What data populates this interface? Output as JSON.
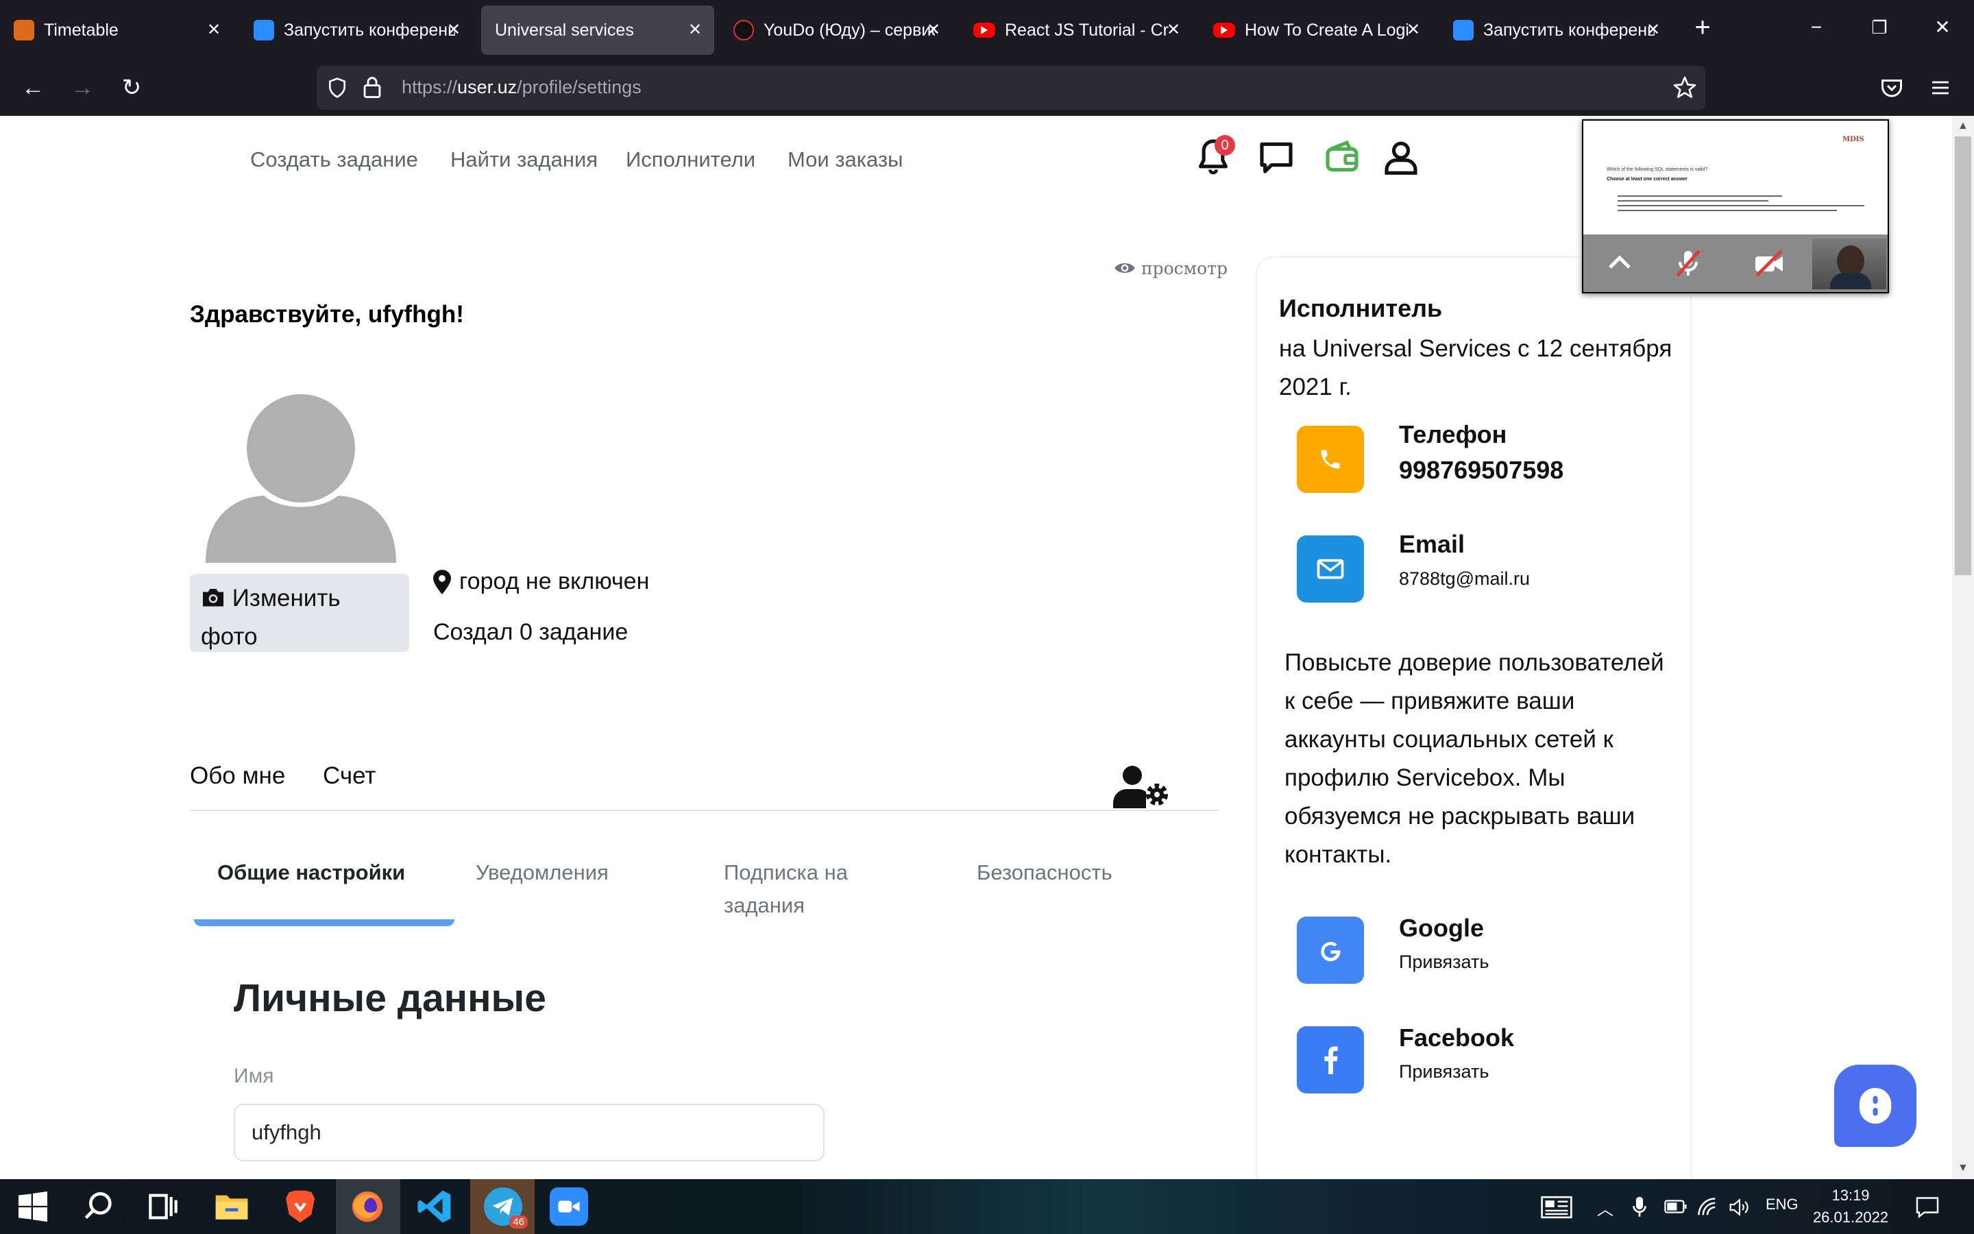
{
  "browser": {
    "tabs": [
      {
        "label": "Timetable",
        "icon": "timetable-favicon"
      },
      {
        "label": "Запустить конференцию",
        "icon": "zoom-favicon"
      },
      {
        "label": "Universal services",
        "icon": "none",
        "active": true
      },
      {
        "label": "YouDo (Юду) – сервис",
        "icon": "youdo-favicon"
      },
      {
        "label": "React JS Tutorial - Create",
        "icon": "youtube-favicon"
      },
      {
        "label": "How To Create A Login",
        "icon": "youtube-favicon"
      },
      {
        "label": "Запустить конференцию",
        "icon": "zoom-favicon"
      }
    ],
    "url_prefix": "https://",
    "url_host": "user.uz",
    "url_path": "/profile/settings"
  },
  "topnav": {
    "items": [
      "Создать задание",
      "Найти задания",
      "Исполнители",
      "Мои заказы"
    ],
    "notification_count": "0"
  },
  "profile": {
    "preview_label": "просмотр",
    "greeting": "Здравствуйте, ufyfhgh!",
    "change_photo_label": "Изменить фото",
    "city": "город не включен",
    "created_tasks": "Создал 0 задание",
    "tabs": [
      "Обо мне",
      "Счет"
    ]
  },
  "settings": {
    "tabs": [
      "Общие настройки",
      "Уведомления",
      "Подписка на задания",
      "Безопасность"
    ],
    "active_tab": "Общие настройки",
    "section_title": "Личные данные",
    "name_label": "Имя",
    "name_value": "ufyfhgh"
  },
  "sidebar": {
    "role": "Исполнитель",
    "member_since": "на Universal Services с 12 сентября 2021 г.",
    "phone_title": "Телефон",
    "phone_value": "998769507598",
    "email_title": "Email",
    "email_value": "8788tg@mail.ru",
    "trust_text": "Повысьте доверие пользователей к себе — привяжите ваши аккаунты социальных сетей к профилю Servicebox. Мы обязуемся не раскрывать ваши контакты.",
    "google_title": "Google",
    "google_action": "Привязать",
    "facebook_title": "Facebook",
    "facebook_action": "Привязать"
  },
  "colors": {
    "phone_icon_bg": "#ffa800",
    "email_icon_bg": "#1e90e0",
    "google_icon_bg": "#4285f4",
    "facebook_icon_bg": "#3b7df5",
    "wallet_icon": "#4caf50",
    "accent_underline": "#5b9cf5",
    "chat_bubble": "#4c6ff0"
  },
  "zoom_popup": {
    "slide_title": "Which of the following SQL statements is valid?",
    "slide_subtitle": "Choose at least one correct answer",
    "logo": "MDIS"
  },
  "taskbar": {
    "telegram_badge": "46",
    "language": "ENG",
    "time": "13:19",
    "date": "26.01.2022"
  }
}
